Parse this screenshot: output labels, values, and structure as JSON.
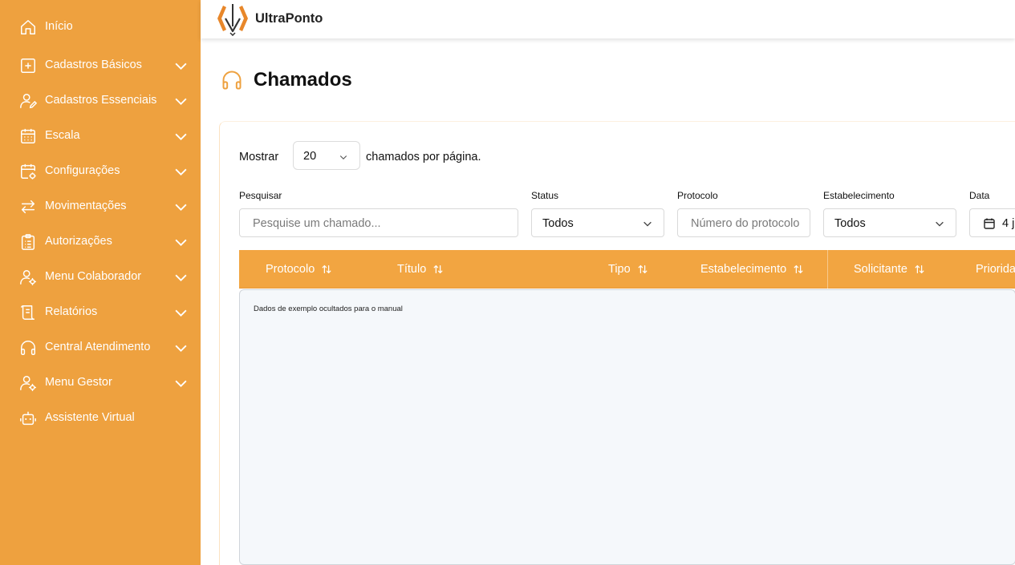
{
  "app": {
    "brand": "UltraPonto"
  },
  "sidebar": {
    "items": [
      {
        "label": "Início",
        "icon": "home-icon",
        "expandable": false
      },
      {
        "label": "Cadastros Básicos",
        "icon": "plus-square-icon",
        "expandable": true
      },
      {
        "label": "Cadastros Essenciais",
        "icon": "user-edit-icon",
        "expandable": true
      },
      {
        "label": "Escala",
        "icon": "calendar-grid-icon",
        "expandable": true
      },
      {
        "label": "Configurações",
        "icon": "calendar-gear-icon",
        "expandable": true
      },
      {
        "label": "Movimentações",
        "icon": "arrows-swap-icon",
        "expandable": true
      },
      {
        "label": "Autorizações",
        "icon": "clipboard-list-icon",
        "expandable": true
      },
      {
        "label": "Menu Colaborador",
        "icon": "user-gear-icon",
        "expandable": true
      },
      {
        "label": "Relatórios",
        "icon": "report-scroll-icon",
        "expandable": true
      },
      {
        "label": "Central Atendimento",
        "icon": "headphones-icon",
        "expandable": true
      },
      {
        "label": "Menu Gestor",
        "icon": "user-gear-icon",
        "expandable": true
      },
      {
        "label": "Assistente Virtual",
        "icon": "robot-icon",
        "expandable": false
      }
    ]
  },
  "page": {
    "title": "Chamados",
    "title_icon": "headphones-icon"
  },
  "pagination": {
    "prefix": "Mostrar",
    "per_page": "20",
    "suffix": "chamados por página."
  },
  "filters": {
    "search": {
      "label": "Pesquisar",
      "placeholder": "Pesquise um chamado..."
    },
    "status": {
      "label": "Status",
      "value": "Todos"
    },
    "protocol": {
      "label": "Protocolo",
      "placeholder": "Número do protocolo"
    },
    "establishment": {
      "label": "Estabelecimento",
      "value": "Todos"
    },
    "date": {
      "label": "Data",
      "value": "4 j"
    }
  },
  "table": {
    "columns": [
      "Protocolo",
      "Título",
      "Tipo",
      "Estabelecimento",
      "Solicitante",
      "Priorida"
    ],
    "empty_message": "Dados de exemplo ocultados para o manual"
  },
  "colors": {
    "accent": "#eea13f",
    "table_header": "#f2a541",
    "body_bg": "#f5f8fb"
  }
}
